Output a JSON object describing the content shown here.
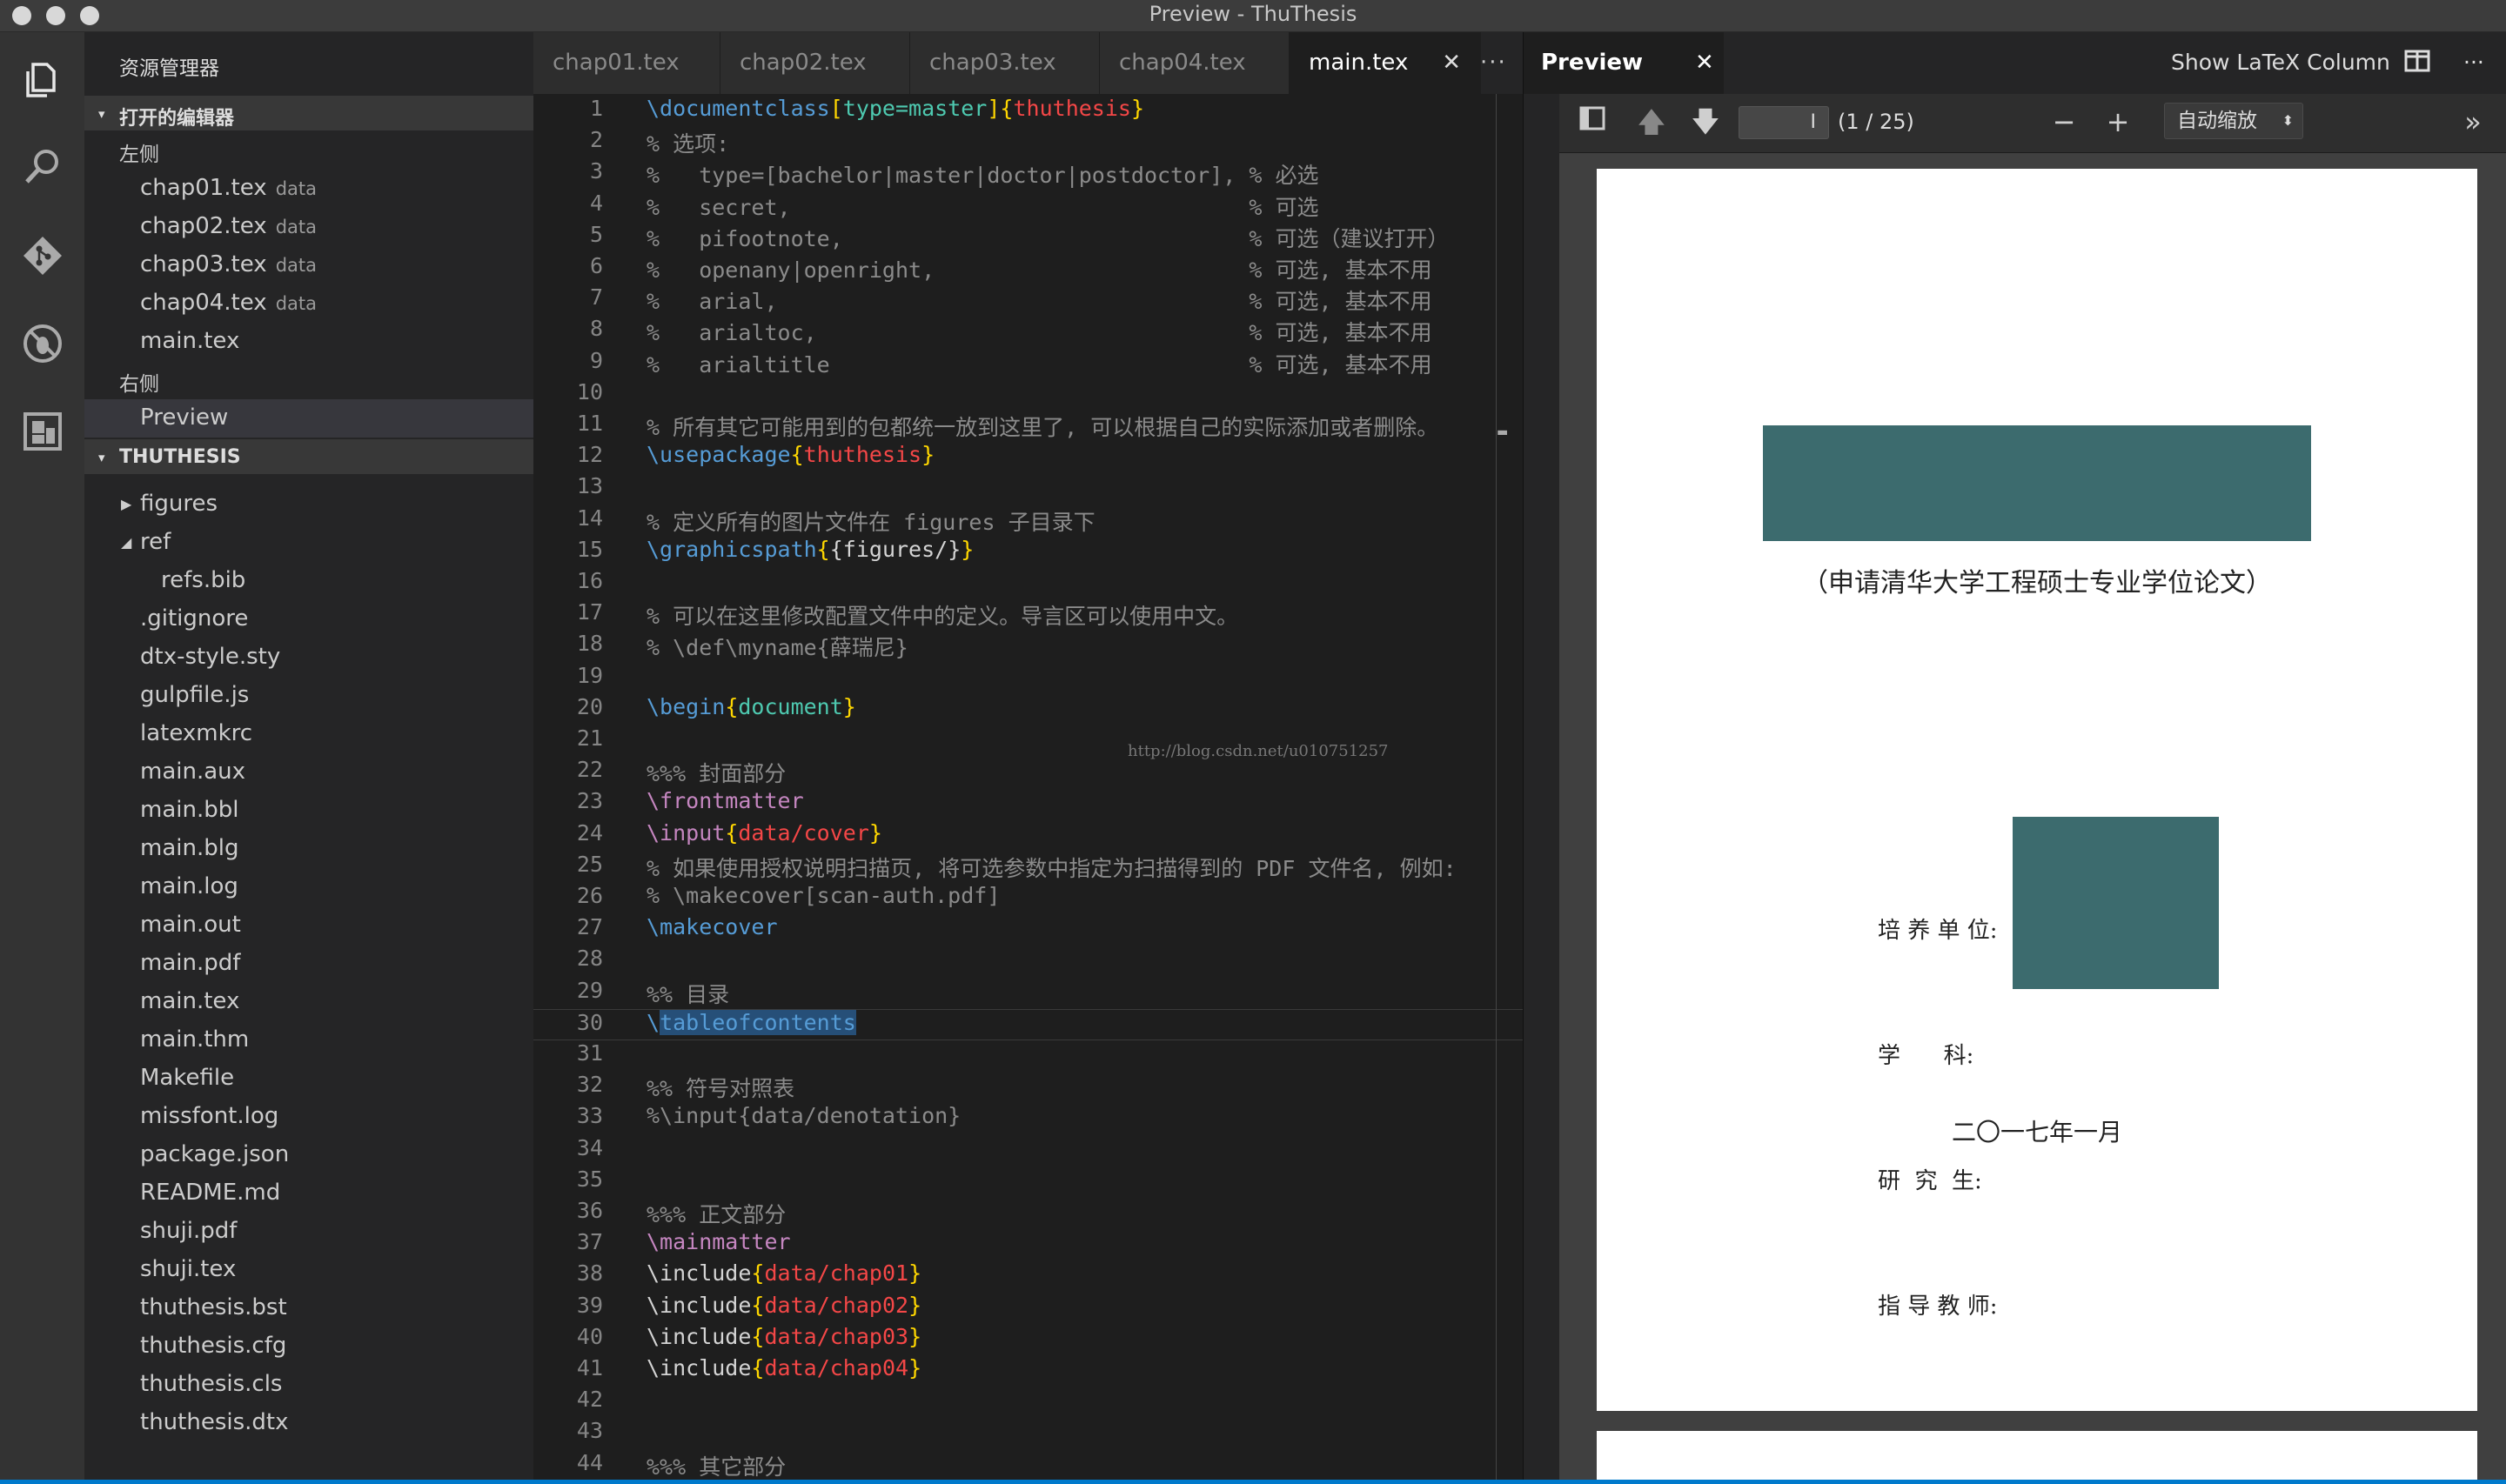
{
  "window": {
    "title": "Preview - ThuThesis"
  },
  "activity_bar": {
    "icons": [
      "files-icon",
      "search-icon",
      "git-icon",
      "debug-icon",
      "extensions-icon"
    ]
  },
  "sidebar": {
    "title": "资源管理器",
    "open_editors": {
      "header": "打开的编辑器",
      "left_group": "左侧",
      "right_group": "右侧",
      "left_items": [
        {
          "name": "chap01.tex",
          "desc": "data"
        },
        {
          "name": "chap02.tex",
          "desc": "data"
        },
        {
          "name": "chap03.tex",
          "desc": "data"
        },
        {
          "name": "chap04.tex",
          "desc": "data"
        },
        {
          "name": "main.tex",
          "desc": ""
        }
      ],
      "right_items": [
        {
          "name": "Preview"
        }
      ]
    },
    "project": {
      "header": "THUTHESIS",
      "folders": [
        "figures",
        "ref"
      ],
      "ref_children": [
        "refs.bib"
      ],
      "files": [
        ".gitignore",
        "dtx-style.sty",
        "gulpfile.js",
        "latexmkrc",
        "main.aux",
        "main.bbl",
        "main.blg",
        "main.log",
        "main.out",
        "main.pdf",
        "main.tex",
        "main.thm",
        "Makefile",
        "missfont.log",
        "package.json",
        "README.md",
        "shuji.pdf",
        "shuji.tex",
        "thuthesis.bst",
        "thuthesis.cfg",
        "thuthesis.cls",
        "thuthesis.dtx"
      ]
    }
  },
  "editor": {
    "tabs": [
      "chap01.tex",
      "chap02.tex",
      "chap03.tex",
      "chap04.tex",
      "main.tex"
    ],
    "active_tab": "main.tex",
    "more": "···",
    "watermark": "http://blog.csdn.net/u010751257",
    "current_line": 30,
    "lines": [
      [
        [
          "\\documentclass",
          "k"
        ],
        [
          "[",
          "b"
        ],
        [
          "type=master",
          "g"
        ],
        [
          "]",
          "b"
        ],
        [
          "{",
          "b"
        ],
        [
          "thuthesis",
          "r"
        ],
        [
          "}",
          "b"
        ]
      ],
      [
        [
          "% 选项:",
          "c"
        ]
      ],
      [
        [
          "%   type=[bachelor|master|doctor|postdoctor], % 必选",
          "c"
        ]
      ],
      [
        [
          "%   secret,                                   % 可选",
          "c"
        ]
      ],
      [
        [
          "%   pifootnote,                               % 可选（建议打开）",
          "c"
        ]
      ],
      [
        [
          "%   openany|openright,                        % 可选, 基本不用",
          "c"
        ]
      ],
      [
        [
          "%   arial,                                    % 可选, 基本不用",
          "c"
        ]
      ],
      [
        [
          "%   arialtoc,                                 % 可选, 基本不用",
          "c"
        ]
      ],
      [
        [
          "%   arialtitle                                % 可选, 基本不用",
          "c"
        ]
      ],
      [],
      [
        [
          "% 所有其它可能用到的包都统一放到这里了, 可以根据自己的实际添加或者删除。",
          "c"
        ]
      ],
      [
        [
          "\\usepackage",
          "k"
        ],
        [
          "{",
          "b"
        ],
        [
          "thuthesis",
          "r"
        ],
        [
          "}",
          "b"
        ]
      ],
      [],
      [
        [
          "% 定义所有的图片文件在 figures 子目录下",
          "c"
        ]
      ],
      [
        [
          "\\graphicspath",
          "k"
        ],
        [
          "{",
          "b"
        ],
        [
          "{figures/}",
          "w"
        ],
        [
          "}",
          "b"
        ]
      ],
      [],
      [
        [
          "% 可以在这里修改配置文件中的定义。导言区可以使用中文。",
          "c"
        ]
      ],
      [
        [
          "% \\def\\myname{薛瑞尼}",
          "c"
        ]
      ],
      [],
      [
        [
          "\\begin",
          "k"
        ],
        [
          "{",
          "b"
        ],
        [
          "document",
          "g"
        ],
        [
          "}",
          "b"
        ]
      ],
      [],
      [
        [
          "%%% 封面部分",
          "c"
        ]
      ],
      [
        [
          "\\frontmatter",
          "m"
        ]
      ],
      [
        [
          "\\input",
          "m"
        ],
        [
          "{",
          "b"
        ],
        [
          "data/cover",
          "r"
        ],
        [
          "}",
          "b"
        ]
      ],
      [
        [
          "% 如果使用授权说明扫描页, 将可选参数中指定为扫描得到的 PDF 文件名, 例如:",
          "c"
        ]
      ],
      [
        [
          "% \\makecover[scan-auth.pdf]",
          "c"
        ]
      ],
      [
        [
          "\\makecover",
          "k"
        ]
      ],
      [],
      [
        [
          "%% 目录",
          "c"
        ]
      ],
      [
        [
          "\\",
          "k"
        ],
        [
          "tableofcontents",
          "hlk"
        ]
      ],
      [],
      [
        [
          "%% 符号对照表",
          "c"
        ]
      ],
      [
        [
          "%\\input{data/denotation}",
          "c"
        ]
      ],
      [],
      [],
      [
        [
          "%%% 正文部分",
          "c"
        ]
      ],
      [
        [
          "\\mainmatter",
          "m"
        ]
      ],
      [
        [
          "\\include",
          "w"
        ],
        [
          "{",
          "b"
        ],
        [
          "data/chap01",
          "r"
        ],
        [
          "}",
          "b"
        ]
      ],
      [
        [
          "\\include",
          "w"
        ],
        [
          "{",
          "b"
        ],
        [
          "data/chap02",
          "r"
        ],
        [
          "}",
          "b"
        ]
      ],
      [
        [
          "\\include",
          "w"
        ],
        [
          "{",
          "b"
        ],
        [
          "data/chap03",
          "r"
        ],
        [
          "}",
          "b"
        ]
      ],
      [
        [
          "\\include",
          "w"
        ],
        [
          "{",
          "b"
        ],
        [
          "data/chap04",
          "r"
        ],
        [
          "}",
          "b"
        ]
      ],
      [],
      [],
      [
        [
          "%%% 其它部分",
          "c"
        ]
      ]
    ]
  },
  "preview": {
    "tab_label": "Preview",
    "show_latex": "Show LaTeX Column",
    "more": "···",
    "page_input": "I",
    "page_count": "(1 / 25)",
    "zoom": "自动缩放",
    "doc": {
      "subtitle": "（申请清华大学工程硕士专业学位论文）",
      "fields": [
        "培 养 单 位:",
        "学      科:",
        "研  究  生:",
        "指 导 教 师:"
      ],
      "date": "二〇一七年一月",
      "redact_color": "#3c6b6e"
    }
  }
}
